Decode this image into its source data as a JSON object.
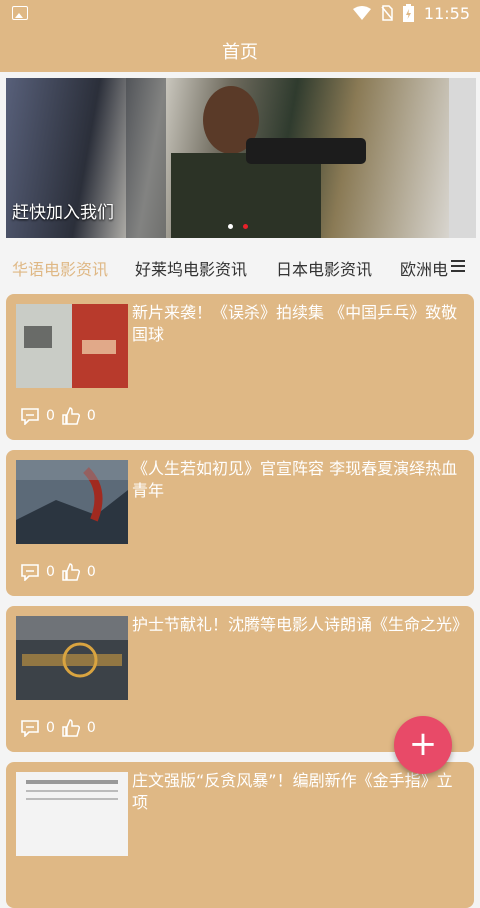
{
  "status": {
    "time": "11:55"
  },
  "app_bar": {
    "title": "首页"
  },
  "banner": {
    "caption": "赶快加入我们"
  },
  "tabs": [
    {
      "label": "华语电影资讯"
    },
    {
      "label": "好莱坞电影资讯"
    },
    {
      "label": "日本电影资讯"
    },
    {
      "label": "欧洲电"
    }
  ],
  "articles": [
    {
      "title": "新片来袭！《误杀》拍续集 《中国乒乓》致敬国球",
      "comments": "0",
      "likes": "0"
    },
    {
      "title": "《人生若如初见》官宣阵容 李现春夏演绎热血青年",
      "comments": "0",
      "likes": "0"
    },
    {
      "title": "护士节献礼！沈腾等电影人诗朗诵《生命之光》",
      "comments": "0",
      "likes": "0"
    },
    {
      "title": "庄文强版“反贪风暴”！编剧新作《金手指》立项",
      "comments": "",
      "likes": ""
    }
  ],
  "colors": {
    "accent": "#dfb885",
    "fab": "#e84a68",
    "dot_active": "#e8212a"
  }
}
